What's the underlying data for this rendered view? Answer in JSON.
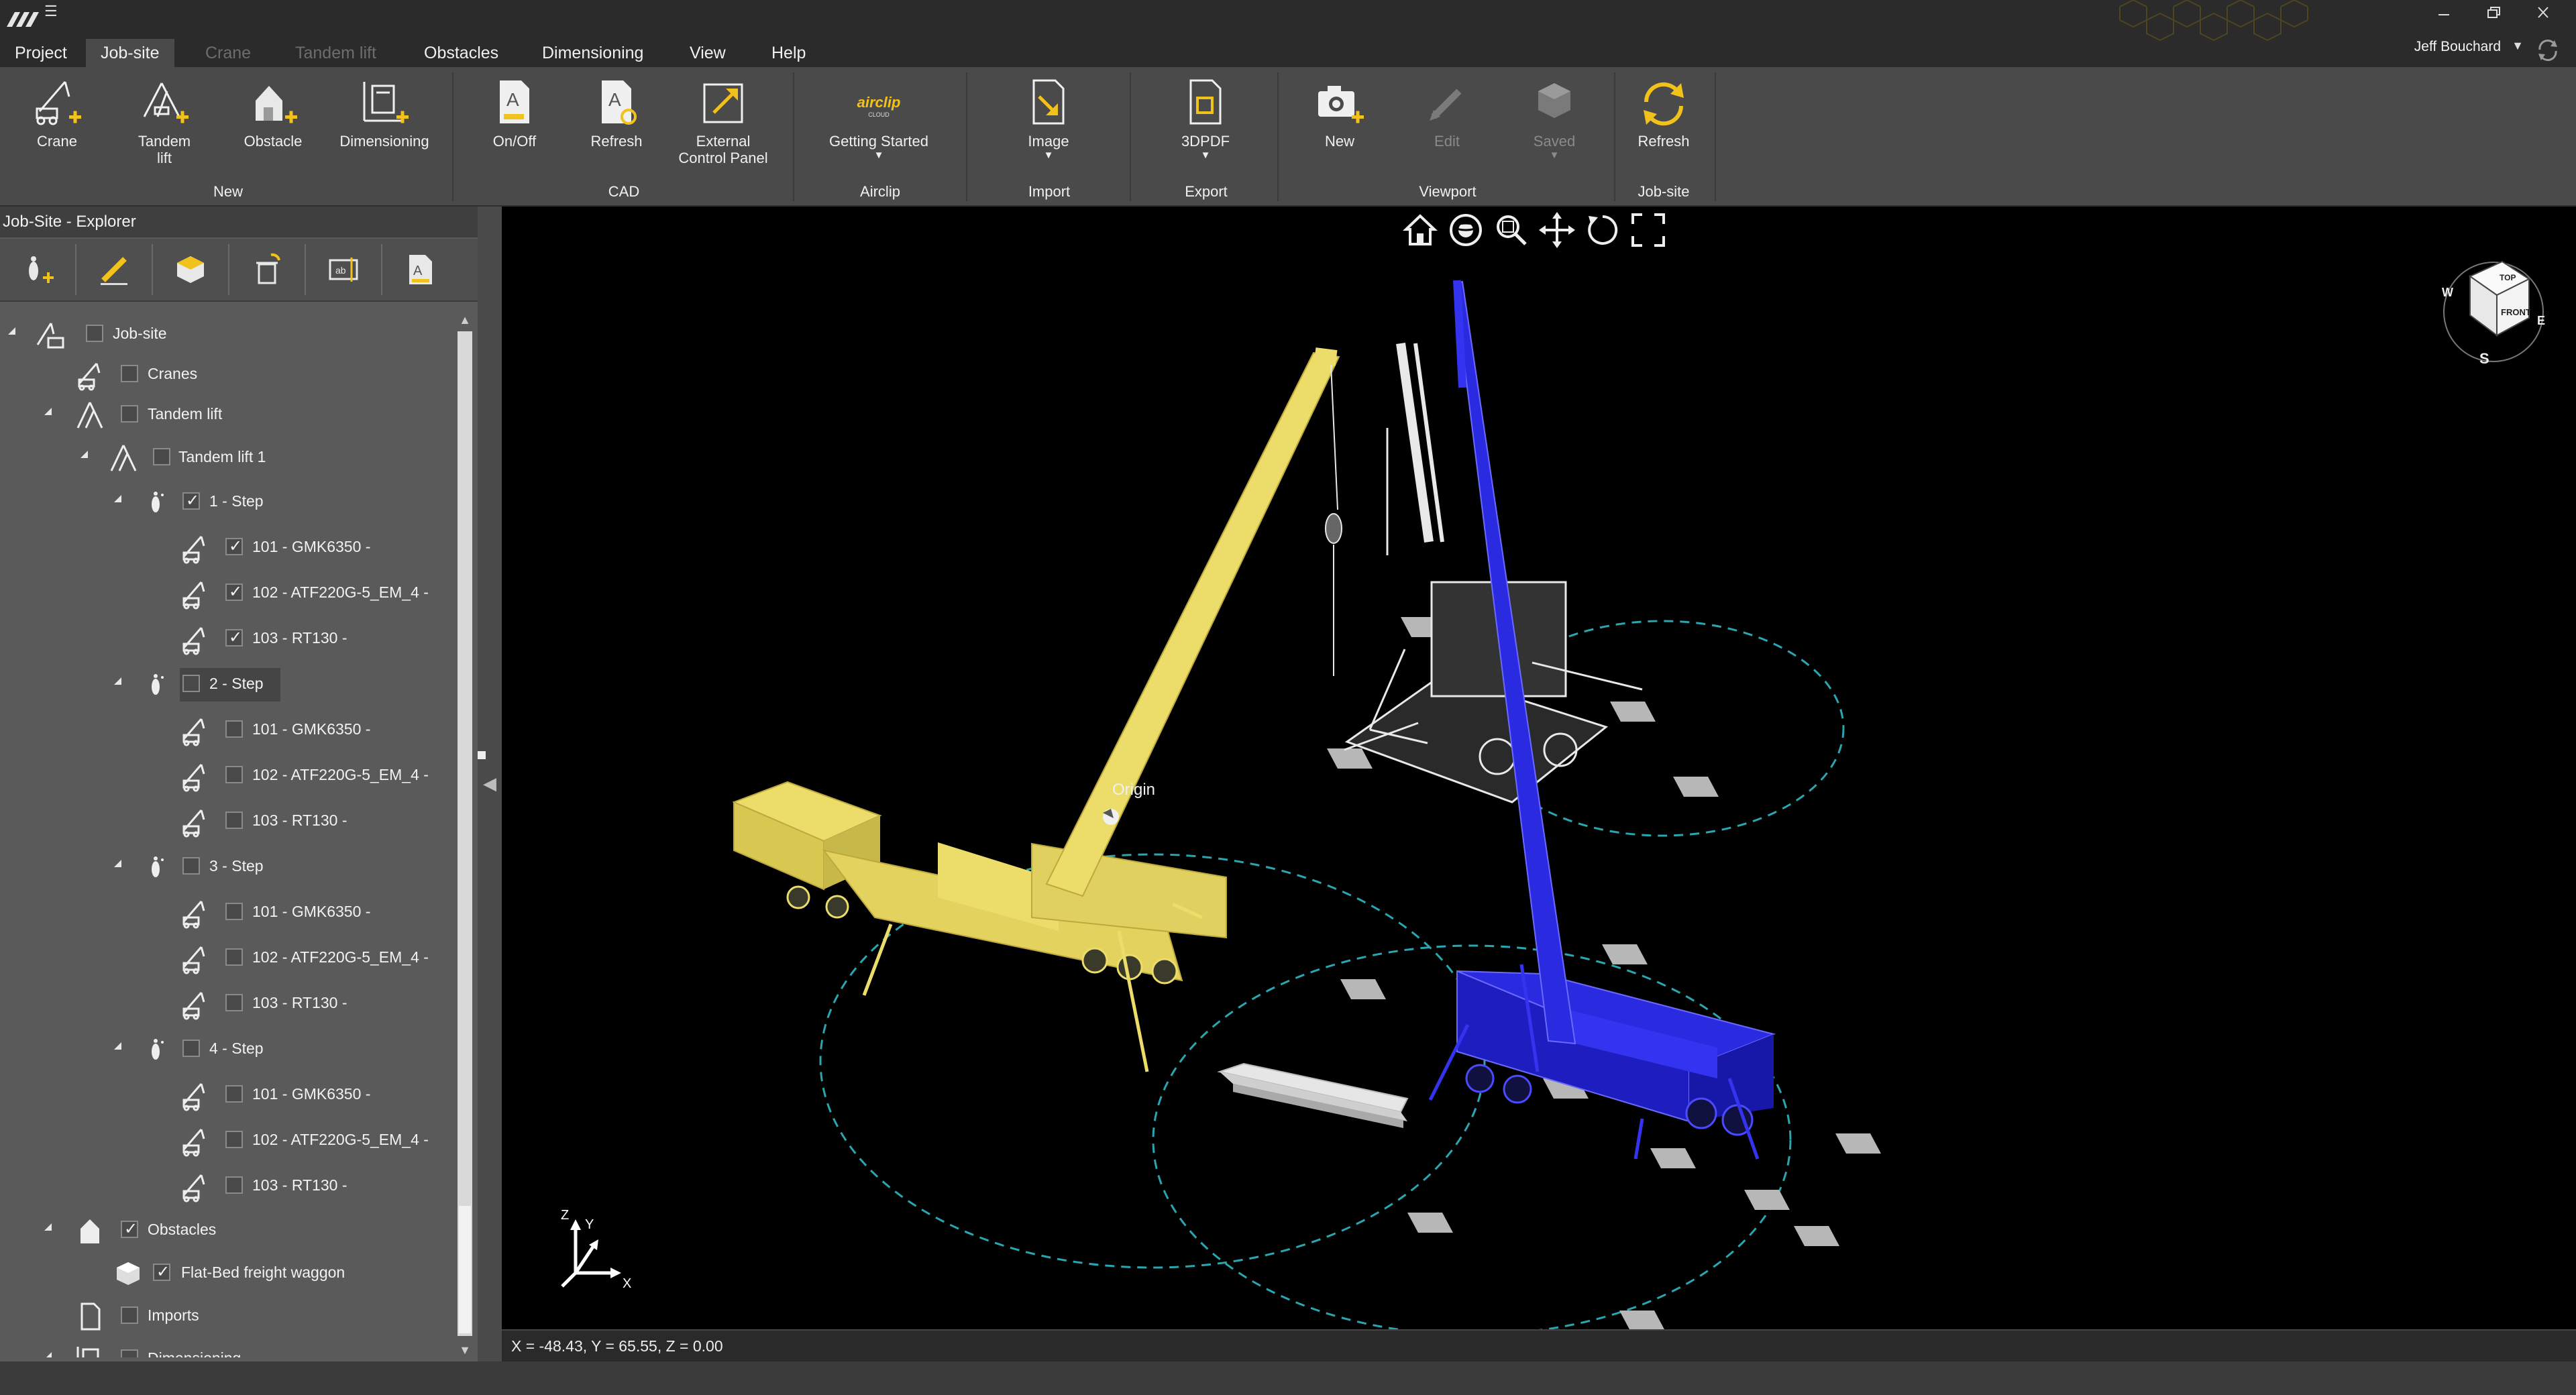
{
  "menu": {
    "tabs": [
      {
        "label": "Project",
        "state": "normal"
      },
      {
        "label": "Job-site",
        "state": "active"
      },
      {
        "label": "Crane",
        "state": "disabled"
      },
      {
        "label": "Tandem lift",
        "state": "disabled"
      },
      {
        "label": "Obstacles",
        "state": "normal"
      },
      {
        "label": "Dimensioning",
        "state": "normal"
      },
      {
        "label": "View",
        "state": "normal"
      },
      {
        "label": "Help",
        "state": "normal"
      }
    ],
    "user": "Jeff Bouchard"
  },
  "ribbon": {
    "buttons": {
      "crane": "Crane",
      "tandem_lift": "Tandem\nlift",
      "obstacle": "Obstacle",
      "dimensioning": "Dimensioning",
      "onoff": "On/Off",
      "refresh_cad": "Refresh",
      "external_panel": "External\nControl Panel",
      "getting_started": "Getting Started",
      "image": "Image",
      "pdf3d": "3DPDF",
      "new_view": "New",
      "edit_view": "Edit",
      "saved_view": "Saved",
      "refresh_site": "Refresh"
    },
    "airclip_logo": "airclip",
    "airclip_logo_sub": "CLOUD",
    "groups": {
      "new": "New",
      "cad": "CAD",
      "airclip": "Airclip",
      "import": "Import",
      "export": "Export",
      "viewport": "Viewport",
      "jobsite": "Job-site"
    }
  },
  "explorer": {
    "title": "Job-Site - Explorer",
    "tree": [
      {
        "label": "Job-site",
        "checked": false
      },
      {
        "label": "Cranes",
        "checked": false
      },
      {
        "label": "Tandem lift",
        "checked": false
      },
      {
        "label": "Tandem lift 1",
        "checked": false
      },
      {
        "label": "1 - Step",
        "checked": true
      },
      {
        "label": "101 - GMK6350 -",
        "checked": true
      },
      {
        "label": "102 - ATF220G-5_EM_4 -",
        "checked": true
      },
      {
        "label": "103 - RT130 -",
        "checked": true
      },
      {
        "label": "2 - Step",
        "checked": false
      },
      {
        "label": "101 - GMK6350 -",
        "checked": false
      },
      {
        "label": "102 - ATF220G-5_EM_4 -",
        "checked": false
      },
      {
        "label": "103 - RT130 -",
        "checked": false
      },
      {
        "label": "3 - Step",
        "checked": false
      },
      {
        "label": "101 - GMK6350 -",
        "checked": false
      },
      {
        "label": "102 - ATF220G-5_EM_4 -",
        "checked": false
      },
      {
        "label": "103 - RT130 -",
        "checked": false
      },
      {
        "label": "4 - Step",
        "checked": false
      },
      {
        "label": "101 - GMK6350 -",
        "checked": false
      },
      {
        "label": "102 - ATF220G-5_EM_4 -",
        "checked": false
      },
      {
        "label": "103 - RT130 -",
        "checked": false
      },
      {
        "label": "Obstacles",
        "checked": true
      },
      {
        "label": "Flat-Bed freight waggon",
        "checked": true
      },
      {
        "label": "Imports",
        "checked": false
      },
      {
        "label": "Dimensioning",
        "checked": false
      }
    ]
  },
  "viewport": {
    "origin_label": "Origin",
    "navcube": {
      "top": "TOP",
      "front": "FRONT",
      "w": "W",
      "e": "E",
      "s": "S"
    },
    "axes": {
      "z": "Z",
      "y": "Y",
      "x": "X"
    },
    "coords": "X = -48.43, Y = 65.55, Z = 0.00"
  },
  "colors": {
    "crane_yellow": "#ecdc6a",
    "crane_white": "#e8e8e8",
    "crane_blue": "#2a2ae0",
    "radius_circle": "#2aa6b0",
    "accent": "#f2c21c"
  }
}
